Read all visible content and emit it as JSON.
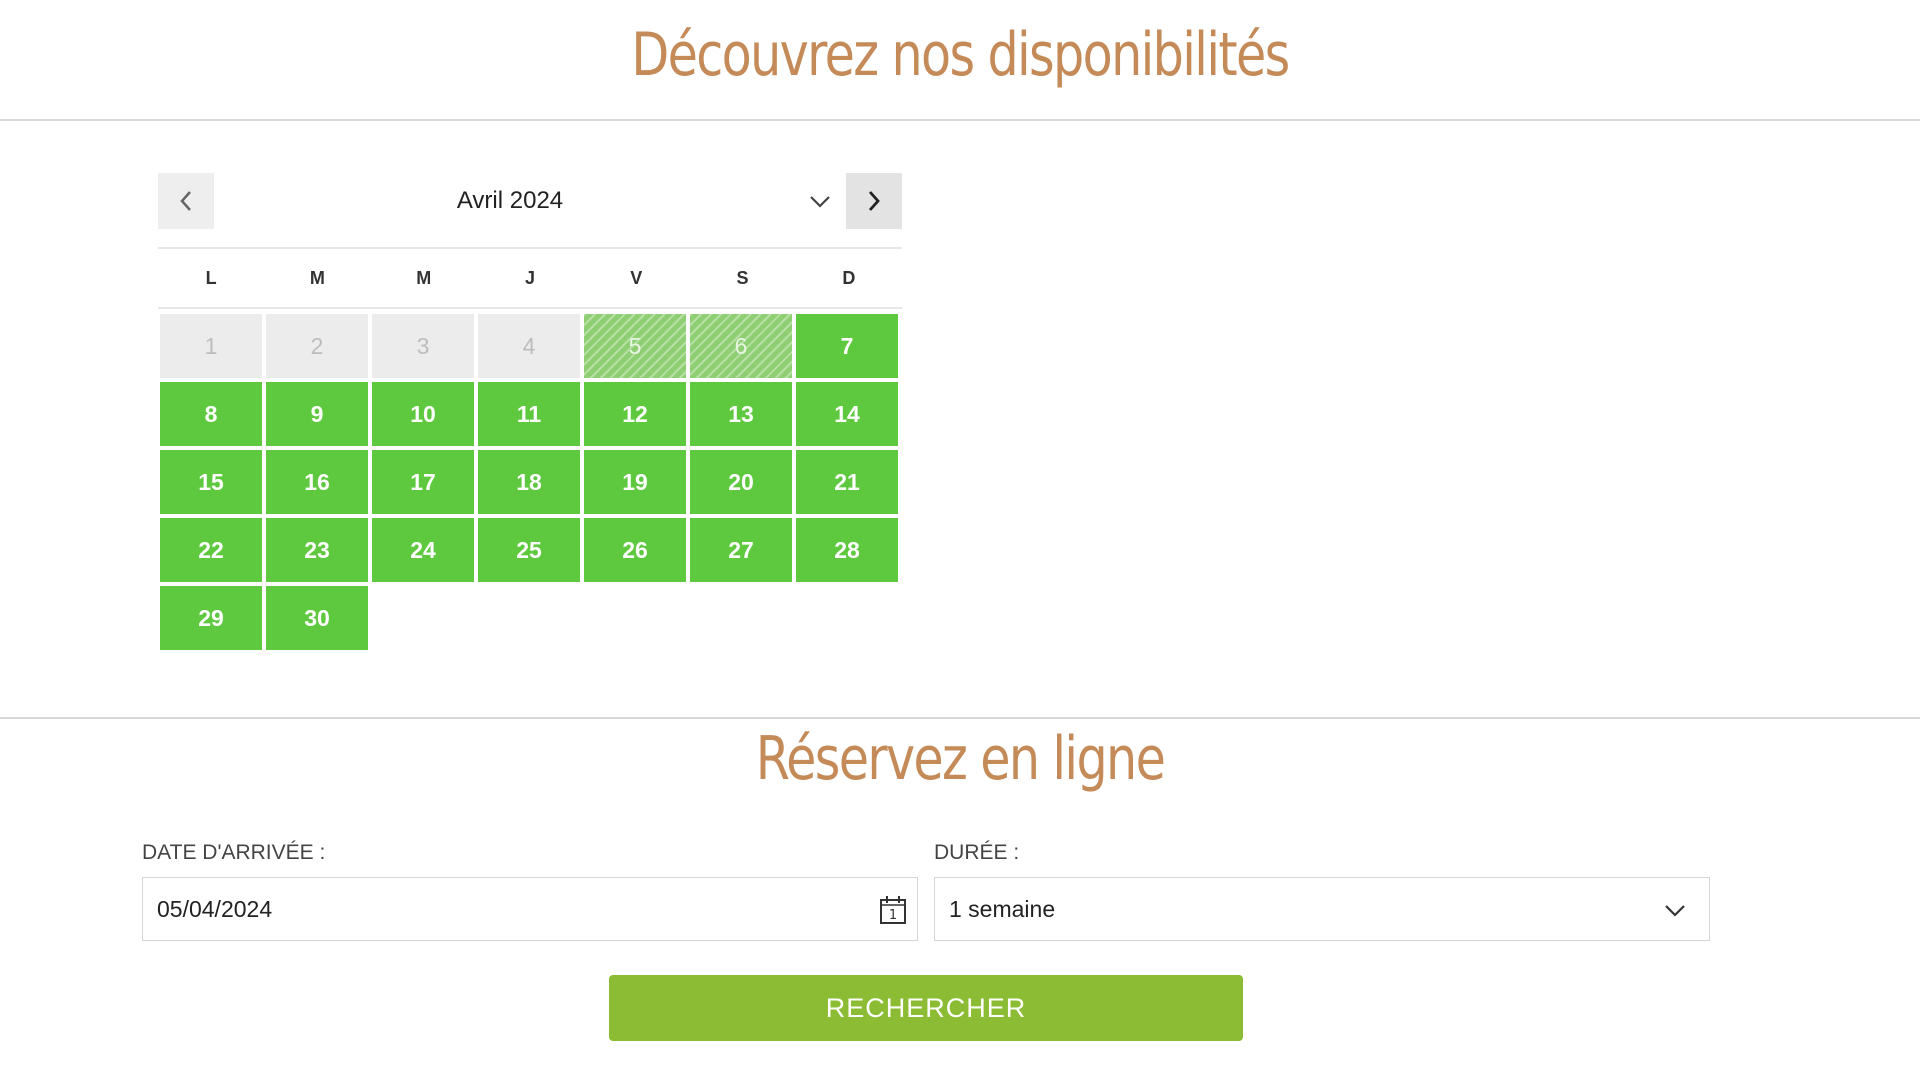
{
  "availability": {
    "title": "Découvrez nos disponibilités"
  },
  "calendar": {
    "month_label": "Avril 2024",
    "weekdays": [
      "L",
      "M",
      "M",
      "J",
      "V",
      "S",
      "D"
    ],
    "days": [
      {
        "label": "1",
        "status": "past"
      },
      {
        "label": "2",
        "status": "past"
      },
      {
        "label": "3",
        "status": "past"
      },
      {
        "label": "4",
        "status": "past"
      },
      {
        "label": "5",
        "status": "partial"
      },
      {
        "label": "6",
        "status": "partial"
      },
      {
        "label": "7",
        "status": "available"
      },
      {
        "label": "8",
        "status": "available"
      },
      {
        "label": "9",
        "status": "available"
      },
      {
        "label": "10",
        "status": "available"
      },
      {
        "label": "11",
        "status": "available"
      },
      {
        "label": "12",
        "status": "available"
      },
      {
        "label": "13",
        "status": "available"
      },
      {
        "label": "14",
        "status": "available"
      },
      {
        "label": "15",
        "status": "available"
      },
      {
        "label": "16",
        "status": "available"
      },
      {
        "label": "17",
        "status": "available"
      },
      {
        "label": "18",
        "status": "available"
      },
      {
        "label": "19",
        "status": "available"
      },
      {
        "label": "20",
        "status": "available"
      },
      {
        "label": "21",
        "status": "available"
      },
      {
        "label": "22",
        "status": "available"
      },
      {
        "label": "23",
        "status": "available"
      },
      {
        "label": "24",
        "status": "available"
      },
      {
        "label": "25",
        "status": "available"
      },
      {
        "label": "26",
        "status": "available"
      },
      {
        "label": "27",
        "status": "available"
      },
      {
        "label": "28",
        "status": "available"
      },
      {
        "label": "29",
        "status": "available"
      },
      {
        "label": "30",
        "status": "available"
      }
    ],
    "colors": {
      "available": "#5ec93f",
      "past": "#ececec",
      "partial": "#8fcf74"
    },
    "icons": {
      "prev": "chevron-left-icon",
      "next": "chevron-right-icon",
      "month_select": "chevron-down-icon"
    }
  },
  "booking": {
    "title": "Réservez en ligne",
    "arrival_label": "DATE D'ARRIVÉE :",
    "arrival_value": "05/04/2024",
    "duration_label": "DURÉE :",
    "duration_value": "1 semaine",
    "search_label": "RECHERCHER",
    "colors": {
      "title": "#c48a57",
      "search_button": "#8cbc34"
    }
  }
}
